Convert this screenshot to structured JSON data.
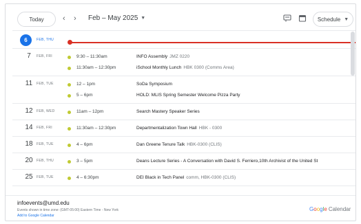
{
  "toolbar": {
    "today_label": "Today",
    "prev_label": "‹",
    "next_label": "›",
    "date_range": "Feb – May 2025",
    "view_label": "Schedule"
  },
  "today": {
    "day": "6",
    "label": "FEB, THU"
  },
  "days": [
    {
      "day": "7",
      "label": "FEB, FRI",
      "events": [
        {
          "time": "9:30 – 11:30am",
          "title": "INFO Assembly",
          "location": "JMZ 0220"
        },
        {
          "time": "11:30am – 12:30pm",
          "title": "iSchool Monthly Lunch",
          "location": "HBK 0300 (Comms Area)"
        }
      ]
    },
    {
      "day": "11",
      "label": "FEB, TUE",
      "events": [
        {
          "time": "12 – 1pm",
          "title": "SoDa Symposium",
          "location": ""
        },
        {
          "time": "5 – 6pm",
          "title": "HOLD: MLIS Spring Semester Welcome Pizza Party",
          "location": ""
        }
      ]
    },
    {
      "day": "12",
      "label": "FEB, WED",
      "events": [
        {
          "time": "11am – 12pm",
          "title": "Search Mastery Speaker Series",
          "location": ""
        }
      ]
    },
    {
      "day": "14",
      "label": "FEB, FRI",
      "events": [
        {
          "time": "11:30am – 12:30pm",
          "title": "Departmentalization Town Hall",
          "location": "HBK - 0300"
        }
      ]
    },
    {
      "day": "18",
      "label": "FEB, TUE",
      "events": [
        {
          "time": "4 – 6pm",
          "title": "Dan Greene Tenure Talk",
          "location": "HBK-0300 (CLIS)"
        }
      ]
    },
    {
      "day": "20",
      "label": "FEB, THU",
      "events": [
        {
          "time": "3 – 5pm",
          "title": "Deans Lecture Series - A Conversation with David S. Ferriero,10th Archivist of the United St",
          "location": ""
        }
      ]
    },
    {
      "day": "25",
      "label": "FEB, TUE",
      "events": [
        {
          "time": "4 – 6:30pm",
          "title": "DEI Black in Tech Panel",
          "location": "comm, HBK-0300 (CLIS)"
        }
      ]
    }
  ],
  "footer": {
    "email": "infoevents@umd.edu",
    "timezone": "Events shown in time zone: (GMT-05:00) Eastern Time - New York",
    "add_link": "Add to Google Calendar",
    "brand_letters": [
      "G",
      "o",
      "o",
      "g",
      "l",
      "e"
    ],
    "brand_suffix": "Calendar"
  },
  "colors": {
    "accent": "#1a73e8",
    "now_line": "#d93025",
    "event_dot": "#c0ca33",
    "brand": [
      "#4285f4",
      "#ea4335",
      "#fbbc05",
      "#4285f4",
      "#34a853",
      "#ea4335"
    ]
  }
}
